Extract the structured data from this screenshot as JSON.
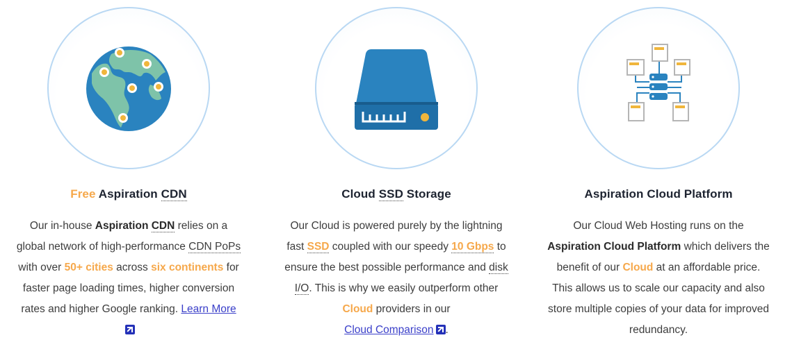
{
  "features": [
    {
      "icon": "globe-icon",
      "title": {
        "hl": "Free",
        "pre": " ",
        "bold": "Aspiration",
        "sp": " ",
        "dotted": "CDN"
      },
      "body": {
        "l1_a": "Our in-house ",
        "l1_b": "Aspiration",
        "l1_c": " ",
        "l1_d": "CDN",
        "l1_e": " relies on a",
        "l2_a": "global network of high-performance ",
        "l2_b": "CDN PoPs",
        "l3_a": "with over ",
        "l3_b": "50+ cities",
        "l3_c": " across ",
        "l3_d": "six continents",
        "l3_e": " for",
        "l4": "faster page loading times, higher conversion",
        "l5_a": "rates and higher Google ranking. ",
        "l5_link": "Learn More"
      }
    },
    {
      "icon": "ssd-drive-icon",
      "title": {
        "a": "Cloud ",
        "dotted": "SSD",
        "b": " Storage"
      },
      "body": {
        "l1": "Our Cloud is powered purely by the lightning",
        "l2_a": "fast ",
        "l2_b": "SSD",
        "l2_c": " coupled with our speedy ",
        "l2_d": "10 Gbps",
        "l2_e": " to",
        "l3_a": "ensure the best possible performance and ",
        "l3_b": "disk",
        "l4_a": "I/O",
        "l4_b": ". This is why we easily outperform other",
        "l5_a": "Cloud",
        "l5_b": " providers in our",
        "l6_link": "Cloud Comparison",
        "l6_end": "."
      }
    },
    {
      "icon": "server-network-icon",
      "title": "Aspiration Cloud Platform",
      "body": {
        "l1": "Our Cloud Web Hosting runs on the",
        "l2_a": "Aspiration Cloud Platform",
        "l2_b": " which delivers the",
        "l3_a": "benefit of our ",
        "l3_b": "Cloud",
        "l3_c": " at an affordable price.",
        "l4": "This allows us to scale our capacity and also",
        "l5": "store multiple copies of your data for improved",
        "l6": "redundancy."
      }
    }
  ],
  "colors": {
    "highlight": "#f6a84b",
    "title": "#1d2330",
    "link": "#3a3fc9",
    "circle_border": "#b9d8f3",
    "icon_blue": "#2a83bf"
  }
}
